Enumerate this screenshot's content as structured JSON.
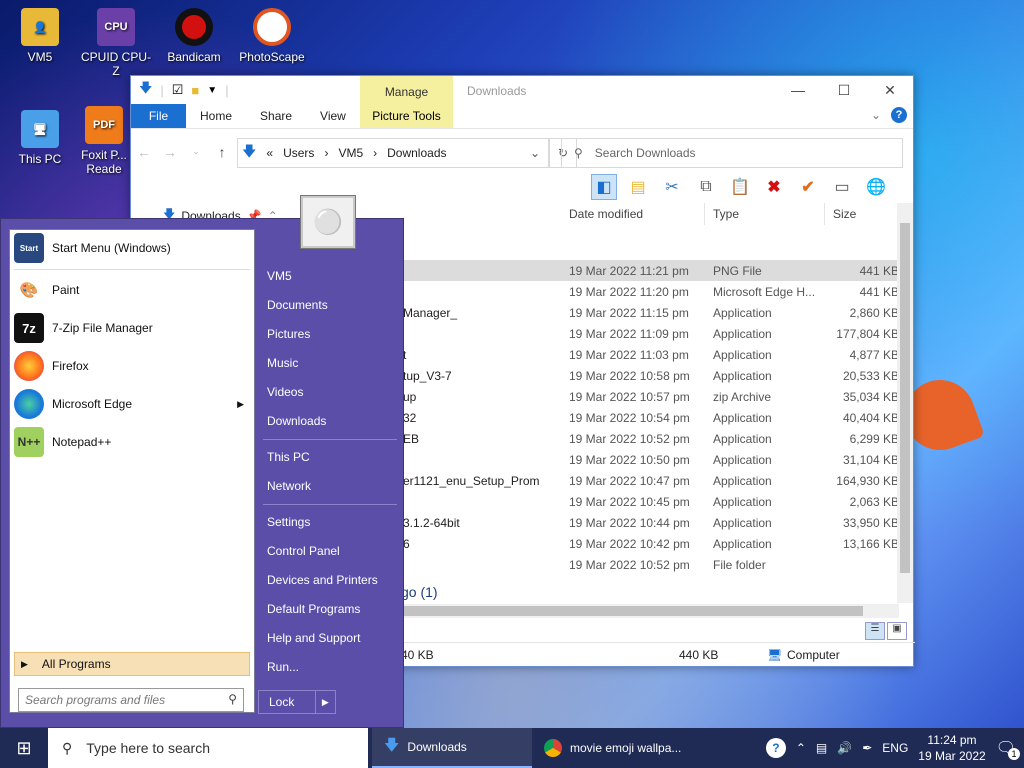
{
  "desktop_icons": [
    {
      "label": "VM5",
      "icon": "folder-user-icon",
      "color": "#e8b838"
    },
    {
      "label": "CPUID CPU-Z",
      "icon": "cpuz-icon",
      "color": "#6a3fa8"
    },
    {
      "label": "Bandicam",
      "icon": "bandicam-icon",
      "color": "#d21010"
    },
    {
      "label": "PhotoScape",
      "icon": "photoscape-icon",
      "color": "#e05520"
    },
    {
      "label": "This PC",
      "icon": "computer-icon",
      "color": "#4aa0e8"
    },
    {
      "label": "Foxit P... Reade",
      "icon": "foxit-icon",
      "color": "#f07b1a"
    }
  ],
  "explorer": {
    "title": "Downloads",
    "manage_tab": "Manage",
    "picture_tools": "Picture Tools",
    "tabs": [
      "File",
      "Home",
      "Share",
      "View"
    ],
    "address": {
      "prefix": "«",
      "crumbs": [
        "Users",
        "VM5",
        "Downloads"
      ]
    },
    "search_placeholder": "Search Downloads",
    "nav_pane_item": "Downloads",
    "columns": {
      "date": "Date modified",
      "type": "Type",
      "size": "Size"
    },
    "files": [
      {
        "name": "",
        "date": "19 Mar 2022 11:21 pm",
        "type": "PNG File",
        "size": "441 KB",
        "selected": true
      },
      {
        "name": "",
        "date": "19 Mar 2022 11:20 pm",
        "type": "Microsoft Edge H...",
        "size": "441 KB"
      },
      {
        "name": "Manager_",
        "date": "19 Mar 2022 11:15 pm",
        "type": "Application",
        "size": "2,860 KB"
      },
      {
        "name": "",
        "date": "19 Mar 2022 11:09 pm",
        "type": "Application",
        "size": "177,804 KB"
      },
      {
        "name": "t",
        "date": "19 Mar 2022 11:03 pm",
        "type": "Application",
        "size": "4,877 KB"
      },
      {
        "name": "tup_V3-7",
        "date": "19 Mar 2022 10:58 pm",
        "type": "Application",
        "size": "20,533 KB"
      },
      {
        "name": "up",
        "date": "19 Mar 2022 10:57 pm",
        "type": "zip Archive",
        "size": "35,034 KB"
      },
      {
        "name": "32",
        "date": "19 Mar 2022 10:54 pm",
        "type": "Application",
        "size": "40,404 KB"
      },
      {
        "name": "EB",
        "date": "19 Mar 2022 10:52 pm",
        "type": "Application",
        "size": "6,299 KB"
      },
      {
        "name": "",
        "date": "19 Mar 2022 10:50 pm",
        "type": "Application",
        "size": "31,104 KB"
      },
      {
        "name": "er1121_enu_Setup_Prom",
        "date": "19 Mar 2022 10:47 pm",
        "type": "Application",
        "size": "164,930 KB"
      },
      {
        "name": "",
        "date": "19 Mar 2022 10:45 pm",
        "type": "Application",
        "size": "2,063 KB"
      },
      {
        "name": "3.1.2-64bit",
        "date": "19 Mar 2022 10:44 pm",
        "type": "Application",
        "size": "33,950 KB"
      },
      {
        "name": "6",
        "date": "19 Mar 2022 10:42 pm",
        "type": "Application",
        "size": "13,166 KB"
      },
      {
        "name": "",
        "date": "19 Mar 2022 10:52 pm",
        "type": "File folder",
        "size": ""
      }
    ],
    "group_header": "go (1)",
    "status": {
      "left": "40 KB",
      "middle": "440 KB",
      "right": "Computer"
    }
  },
  "start_menu": {
    "pinned": [
      {
        "label": "Start Menu (Windows)",
        "icon": "start-menu-icon"
      },
      {
        "label": "Paint",
        "icon": "paint-icon"
      },
      {
        "label": "7-Zip File Manager",
        "icon": "7zip-icon"
      },
      {
        "label": "Firefox",
        "icon": "firefox-icon"
      },
      {
        "label": "Microsoft Edge",
        "icon": "edge-icon"
      },
      {
        "label": "Notepad++",
        "icon": "notepadpp-icon"
      }
    ],
    "all_programs": "All Programs",
    "search_placeholder": "Search programs and files",
    "right_items": [
      "VM5",
      "Documents",
      "Pictures",
      "Music",
      "Videos",
      "Downloads",
      "This PC",
      "Network",
      "Settings",
      "Control Panel",
      "Devices and Printers",
      "Default Programs",
      "Help and Support",
      "Run..."
    ],
    "lock": "Lock"
  },
  "taskbar": {
    "search_placeholder": "Type here to search",
    "apps": [
      {
        "label": "Downloads",
        "icon": "folder-download-icon"
      },
      {
        "label": "movie emoji wallpa...",
        "icon": "chrome-icon"
      }
    ],
    "language": "ENG",
    "time": "11:24 pm",
    "date": "19 Mar 2022",
    "notification_count": "1"
  },
  "colors": {
    "accent": "#1a6fd1",
    "start_menu_bg": "#5a4ea8",
    "manage_tab": "#f5f0a0",
    "all_programs_bg": "#f7dfb6"
  }
}
